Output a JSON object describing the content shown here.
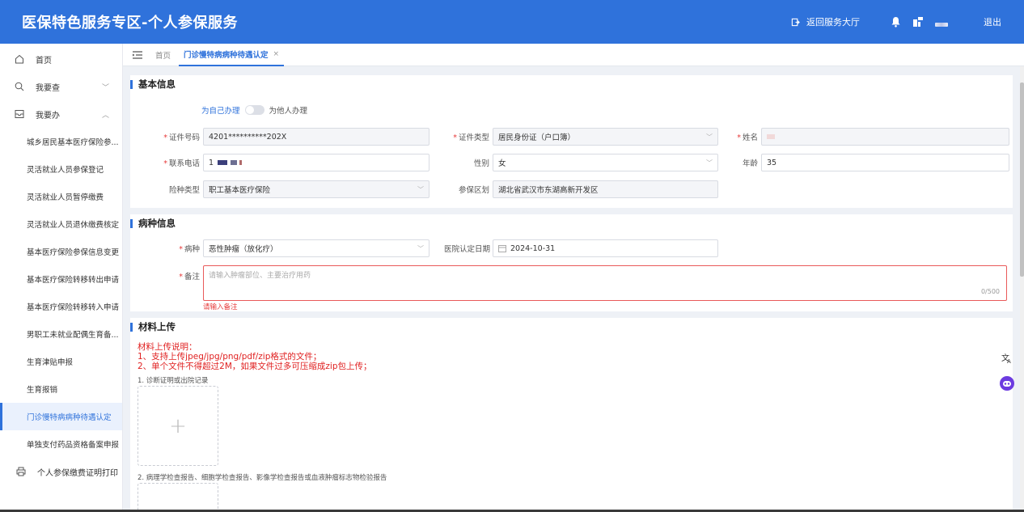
{
  "header": {
    "title": "医保特色服务专区-个人参保服务",
    "back_label": "返回服务大厅",
    "logout_label": "退出",
    "color": "#2f72db"
  },
  "sidebar": {
    "items": [
      {
        "label": "首页",
        "icon": "home-icon"
      },
      {
        "label": "我要查",
        "icon": "search-icon"
      },
      {
        "label": "我要办",
        "icon": "inbox-icon"
      }
    ],
    "sub_items": [
      "城乡居民基本医疗保险参...",
      "灵活就业人员参保登记",
      "灵活就业人员暂停缴费",
      "灵活就业人员退休缴费核定",
      "基本医疗保险参保信息变更",
      "基本医疗保险转移转出申请",
      "基本医疗保险转移转入申请",
      "男职工未就业配偶生育备...",
      "生育津贴申报",
      "生育报销",
      "门诊慢特病病种待遇认定",
      "单独支付药品资格备案申报"
    ],
    "active_index": 10,
    "bottom_item": {
      "label": "个人参保缴费证明打印",
      "icon": "printer-icon"
    }
  },
  "tabs": {
    "home": "首页",
    "active": "门诊慢特病病种待遇认定",
    "close": "×"
  },
  "basic": {
    "title": "基本信息",
    "toggle_self": "为自己办理",
    "toggle_other": "为他人办理",
    "id_label": "证件号码",
    "id_value": "4201**********202X",
    "id_type_label": "证件类型",
    "id_type_value": "居民身份证（户口簿）",
    "name_label": "姓名",
    "phone_label": "联系电话",
    "phone_value": "1",
    "gender_label": "性别",
    "gender_value": "女",
    "age_label": "年龄",
    "age_value": "35",
    "insurance_label": "险种类型",
    "insurance_value": "职工基本医疗保险",
    "region_label": "参保区划",
    "region_value": "湖北省武汉市东湖高新开发区"
  },
  "disease": {
    "title": "病种信息",
    "disease_label": "病种",
    "disease_value": "恶性肿瘤（放化疗）",
    "date_label": "医院认定日期",
    "date_value": "2024-10-31",
    "remark_label": "备注",
    "remark_placeholder": "请输入肿瘤部位、主要治疗用药",
    "remark_count": "0/500",
    "remark_error": "请输入备注"
  },
  "upload": {
    "title": "材料上传",
    "notes": [
      "材料上传说明：",
      "1、支持上传jpeg/jpg/png/pdf/zip格式的文件；",
      "2、单个文件不得超过2M，如果文件过多可压缩成zip包上传；"
    ],
    "item1": "1. 诊断证明或出院记录",
    "item2": "2. 病理学检查报告、细胞学检查报告、影像学检查报告或血液肿瘤标志物检验报告",
    "plus": "+"
  }
}
